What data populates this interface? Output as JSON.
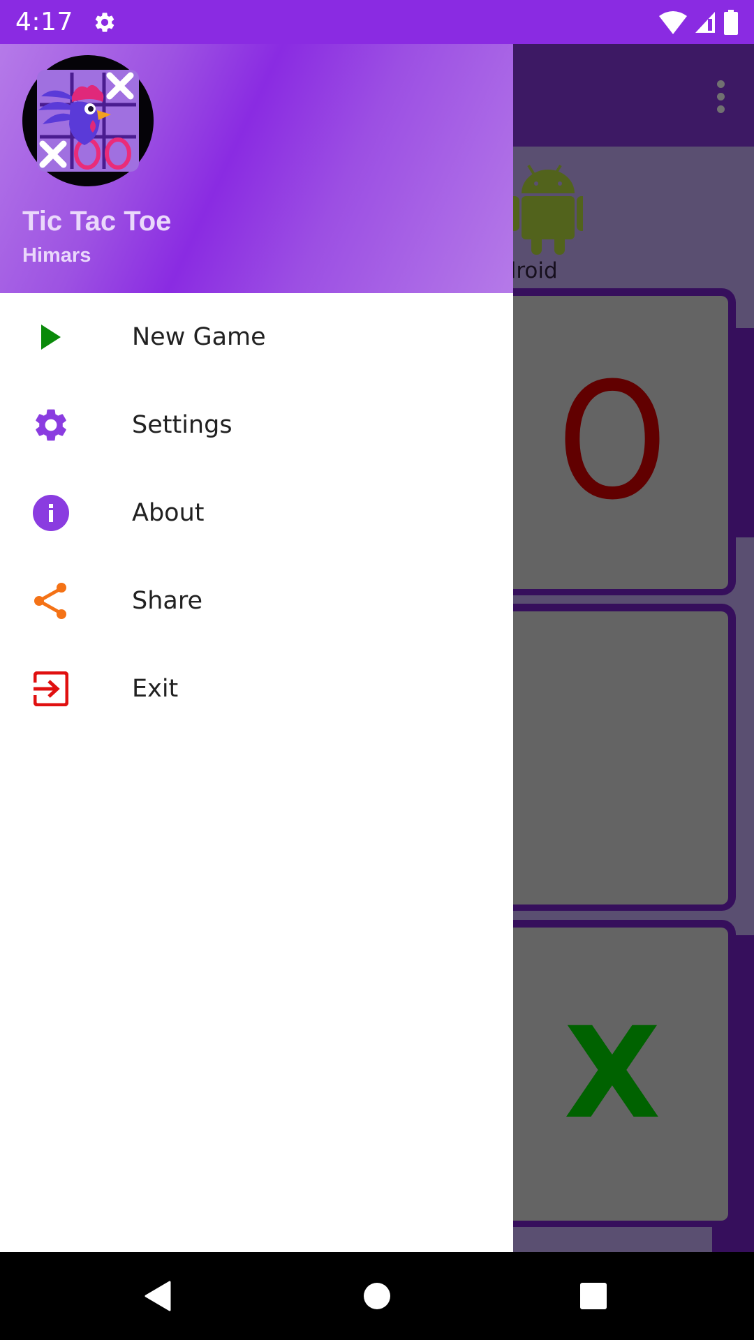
{
  "status_bar": {
    "time": "4:17",
    "icons": [
      "settings-icon",
      "wifi-icon",
      "cellular-signal-icon",
      "battery-icon"
    ]
  },
  "drawer": {
    "header": {
      "title": "Tic Tac Toe",
      "subtitle": "Himars",
      "logo_icon": "rooster-tic-tac-toe-logo",
      "gradient_colors": [
        "#b57ae8",
        "#8a2be2"
      ]
    },
    "items": [
      {
        "label": "New Game",
        "icon": "play-icon",
        "icon_color": "#0a8a0a"
      },
      {
        "label": "Settings",
        "icon": "gear-icon",
        "icon_color": "#8a3ce0"
      },
      {
        "label": "About",
        "icon": "info-icon",
        "icon_color": "#8a3ce0"
      },
      {
        "label": "Share",
        "icon": "share-icon",
        "icon_color": "#f47216"
      },
      {
        "label": "Exit",
        "icon": "exit-icon",
        "icon_color": "#e01010"
      }
    ]
  },
  "background_app": {
    "toolbar": {
      "overflow_icon": "more-vert-icon"
    },
    "player": {
      "label": "ndroid",
      "icon": "android-icon"
    },
    "board_cells": [
      {
        "mark": "O",
        "color": "#c20000"
      },
      {
        "mark": "",
        "color": ""
      },
      {
        "mark": "X",
        "color": "#00c400"
      }
    ]
  },
  "nav_bar": {
    "buttons": [
      "back-icon",
      "home-icon",
      "recents-icon"
    ]
  },
  "colors": {
    "accent": "#8a2be2",
    "app_purple_dark": "#6d1fb8",
    "menu_text": "#212121"
  }
}
